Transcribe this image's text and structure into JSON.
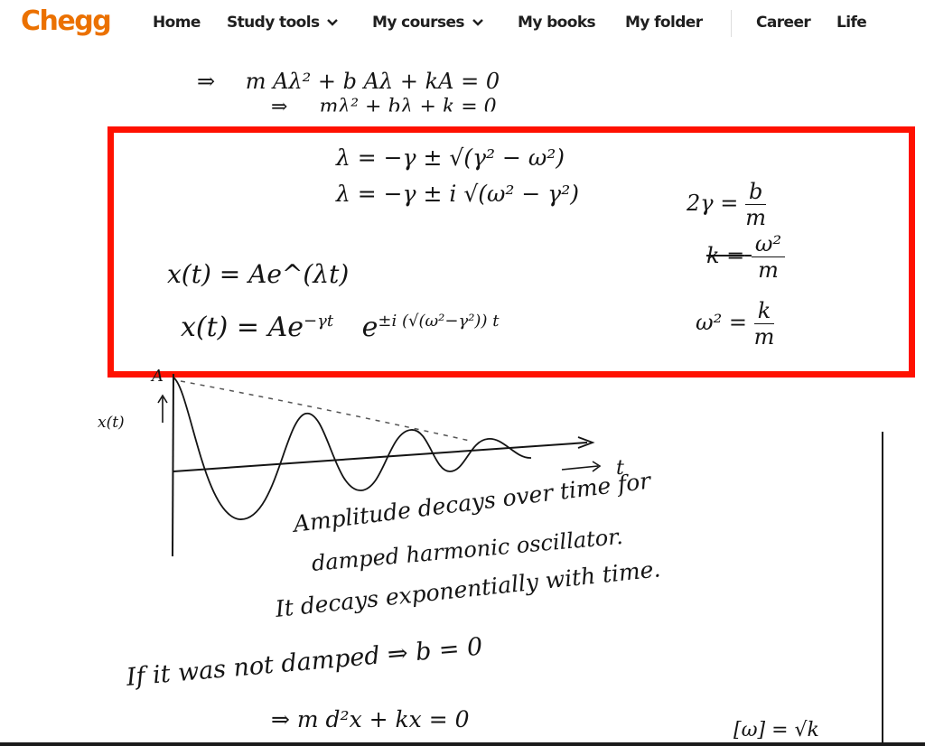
{
  "header": {
    "logo": "Chegg",
    "brand_color": "#eb7100",
    "nav": [
      {
        "label": "Home",
        "has_dropdown": false
      },
      {
        "label": "Study tools",
        "has_dropdown": true
      },
      {
        "label": "My courses",
        "has_dropdown": true
      },
      {
        "label": "My books",
        "has_dropdown": false
      },
      {
        "label": "My folder",
        "has_dropdown": false
      },
      {
        "label": "Career",
        "has_dropdown": false
      },
      {
        "label": "Life",
        "has_dropdown": false
      }
    ]
  },
  "solution_image": {
    "highlight_color": "#ff1100",
    "lines_above": [
      {
        "lead": "⇒",
        "expr": "m Aλ² + b Aλ + kA = 0"
      },
      {
        "lead": "⇒",
        "expr": "mλ² + bλ + k = 0"
      }
    ],
    "highlighted": {
      "lambda_1": "λ = −γ ± √(γ² − ω²)",
      "lambda_2": "λ = −γ ± i √(ω² − γ²)",
      "x_general": "x(t) = Ae^(λt)",
      "x_damped_base": "x(t) = Ae",
      "x_damped_exp1": "−γt",
      "x_damped_e": "e",
      "x_damped_exp2": "±i (√(ω²−γ²)) t",
      "side_1_lhs": "2γ =",
      "side_1_num": "b",
      "side_1_den": "m",
      "side_2_lhs": "k =",
      "side_2_num": "ω²",
      "side_2_den": "m",
      "side_3_lhs": "ω² =",
      "side_3_num": "k",
      "side_3_den": "m"
    },
    "graph": {
      "y_label": "x(t)",
      "amplitude_label": "A",
      "x_label": "t",
      "description": "Damped oscillation with dashed exponentially decaying envelope"
    },
    "notes": [
      "Amplitude decays over time for",
      "damped harmonic oscillator.",
      "It decays exponentially with time."
    ],
    "lines_below": [
      "If it was not damped ⇒ b = 0",
      "⇒ m d²x + kx = 0",
      "[ω] = √k"
    ]
  }
}
